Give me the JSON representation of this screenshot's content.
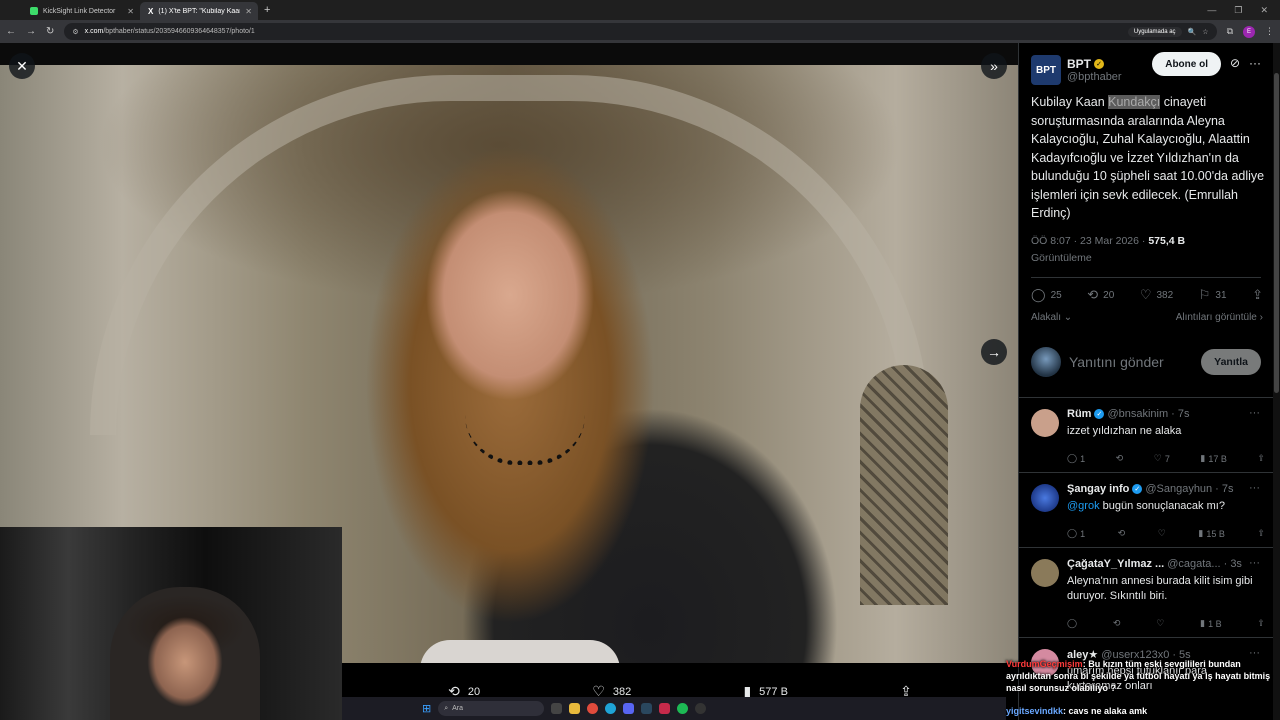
{
  "browser": {
    "tabs": [
      {
        "label": "KickSight Link Detector",
        "active": false
      },
      {
        "label": "(1) X'te BPT: \"Kubilay Kaan Kun",
        "active": true
      }
    ],
    "url_domain": "x.com",
    "url_path": "/bpthaber/status/2035946609364648357/photo/1",
    "app_button": "Uygulamada aç",
    "profile_initial": "E"
  },
  "viewer": {
    "actions": [
      {
        "icon": "retweet-icon",
        "count": "20"
      },
      {
        "icon": "heart-icon",
        "count": "382"
      },
      {
        "icon": "views-icon",
        "count": "577 B"
      },
      {
        "icon": "share-icon",
        "count": ""
      }
    ]
  },
  "post": {
    "author_name": "BPT",
    "author_handle": "@bpthaber",
    "logo_text": "BPT",
    "follow_label": "Abone ol",
    "text_before": "Kubilay Kaan ",
    "text_highlight": "Kundakçı",
    "text_after": " cinayeti soruşturmasında aralarında Aleyna Kalaycıoğlu, Zuhal Kalaycıoğlu, Alaattin Kadayıfcıoğlu ve İzzet Yıldızhan'ın da bulunduğu 10 şüpheli saat 10.00'da adliye işlemleri için sevk edilecek. (Emrullah Erdinç)",
    "time": "ÖÖ 8:07 · 23 Mar 2026 · ",
    "views": "575,4 B",
    "views_label": "Görüntüleme",
    "stats": {
      "replies": "25",
      "retweets": "20",
      "likes": "382",
      "bookmarks": "31"
    },
    "sort_label": "Alakalı",
    "quotes_label": "Alıntıları görüntüle",
    "reply_placeholder": "Yanıtını gönder",
    "reply_button": "Yanıtla"
  },
  "comments": [
    {
      "name": "Rüm",
      "verified": true,
      "handle": "@bnsakinim",
      "time": "· 7s",
      "mention": "",
      "text": "izzet yıldızhan ne alaka",
      "replies": "1",
      "likes": "7",
      "views": "17 B",
      "avatar_color": "#c9a08b"
    },
    {
      "name": "Şangay info",
      "verified": true,
      "handle": "@Sangayhun",
      "time": "· 7s",
      "mention": "@grok",
      "text": " bugün sonuçlanacak mı?",
      "replies": "1",
      "likes": "",
      "views": "15 B",
      "avatar_color": "#2b4fb5"
    },
    {
      "name": "ÇağataY_Yılmaz ...",
      "verified": false,
      "handle": "@cagata...",
      "time": "· 3s",
      "mention": "",
      "text": "Aleyna'nın annesi burada kilit isim gibi duruyor. Sıkıntılı biri.",
      "replies": "",
      "likes": "",
      "views": "1 B",
      "avatar_color": "#8a7a5a"
    },
    {
      "name": "aley★",
      "verified": false,
      "handle": "@userx123x0",
      "time": "· 5s",
      "mention": "",
      "text": "umarım hepsi tutuklanır para kurtaramaz onları",
      "replies": "",
      "likes": "",
      "views": "",
      "avatar_color": "#d48aa0"
    }
  ],
  "chat": [
    {
      "user": "VurdumGeçmişim",
      "message": ": Bu kızın tüm eski sevgilileri bundan ayrıldıktan sonra bi şekilde ya futbol hayatı ya iş hayatı bitmiş nasıl sorunsuz olabiliyo ?"
    },
    {
      "user": "yigitsevindkk",
      "message": ": cavs ne alaka amk"
    }
  ],
  "taskbar": {
    "search_placeholder": "Ara",
    "time": "3:29:26 ÖS",
    "date": "23.03.2026"
  }
}
